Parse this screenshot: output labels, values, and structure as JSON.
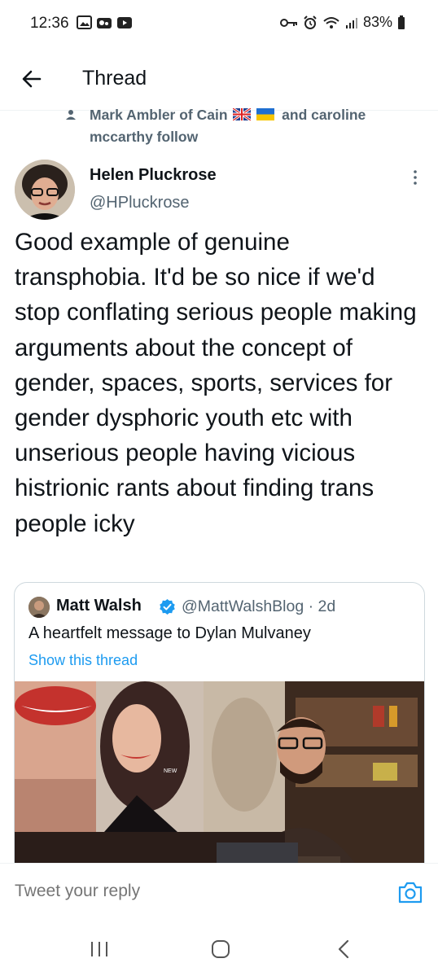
{
  "status_bar": {
    "time": "12:36",
    "battery": "83%",
    "icons_left": [
      "gallery-icon",
      "cloud-icon",
      "youtube-icon"
    ],
    "icons_right": [
      "key-icon",
      "alarm-icon",
      "wifi-icon",
      "signal-icon",
      "battery-icon"
    ]
  },
  "header": {
    "title": "Thread"
  },
  "social_context": {
    "text_before": "Mark Ambler of Cain",
    "text_after": "and caroline mccarthy follow"
  },
  "tweet": {
    "author_name": "Helen Pluckrose",
    "author_handle": "@HPluckrose",
    "text": "Good example of genuine transphobia. It'd be so nice if we'd stop conflating serious people making arguments about the concept of gender, spaces, sports, services for gender dysphoric youth etc with unserious people having vicious histrionic rants about finding trans people icky"
  },
  "quote": {
    "author_name": "Matt Walsh",
    "author_handle": "@MattWalshBlog · 2d",
    "text": "A heartfelt message to Dylan Mulvaney",
    "show_thread": "Show this thread",
    "media_watermark": "NEW"
  },
  "reply": {
    "placeholder": "Tweet your reply"
  },
  "colors": {
    "accent": "#1d9bf0",
    "secondary_text": "#536471",
    "border": "#cfd9de"
  }
}
